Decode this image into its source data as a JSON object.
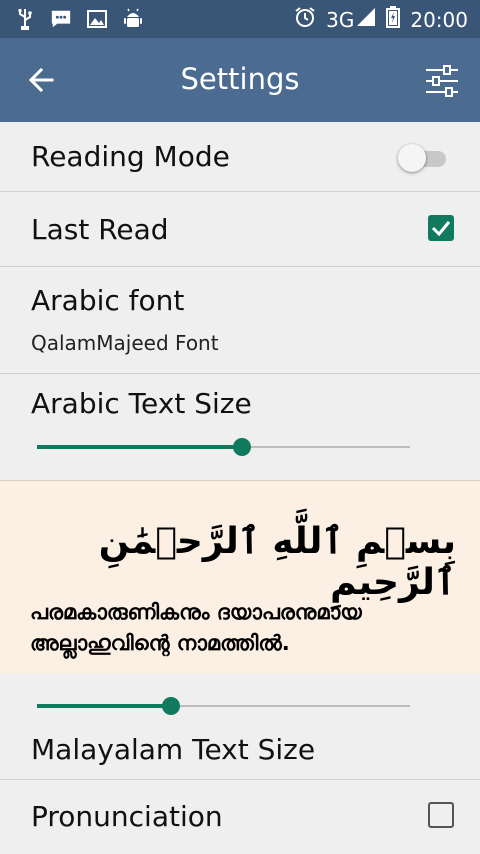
{
  "statusbar": {
    "network": "3G",
    "time": "20:00"
  },
  "toolbar": {
    "title": "Settings"
  },
  "settings": {
    "reading_mode": {
      "label": "Reading Mode",
      "enabled": false
    },
    "last_read": {
      "label": "Last Read",
      "checked": true
    },
    "arabic_font": {
      "label": "Arabic font",
      "value": "QalamMajeed Font"
    },
    "arabic_text_size": {
      "label": "Arabic Text Size",
      "level": 0.55
    },
    "preview": {
      "arabic": "بِسۡمِ ٱللَّهِ ٱلرَّحۡمَٰنِ ٱلرَّحِيمِ",
      "malayalam": "പരമകാരുണികനും ദയാപരനുമായ അല്ലാഹുവിന്റെ നാമത്തിൽ."
    },
    "malayalam_text_size": {
      "label": "Malayalam Text Size",
      "level": 0.36
    },
    "pronunciation": {
      "label": "Pronunciation",
      "checked": false
    }
  },
  "colors": {
    "statusbar": "#3a5677",
    "toolbar": "#4b6b91",
    "accent": "#0f7a5e",
    "preview_bg": "#fbf0e3"
  }
}
